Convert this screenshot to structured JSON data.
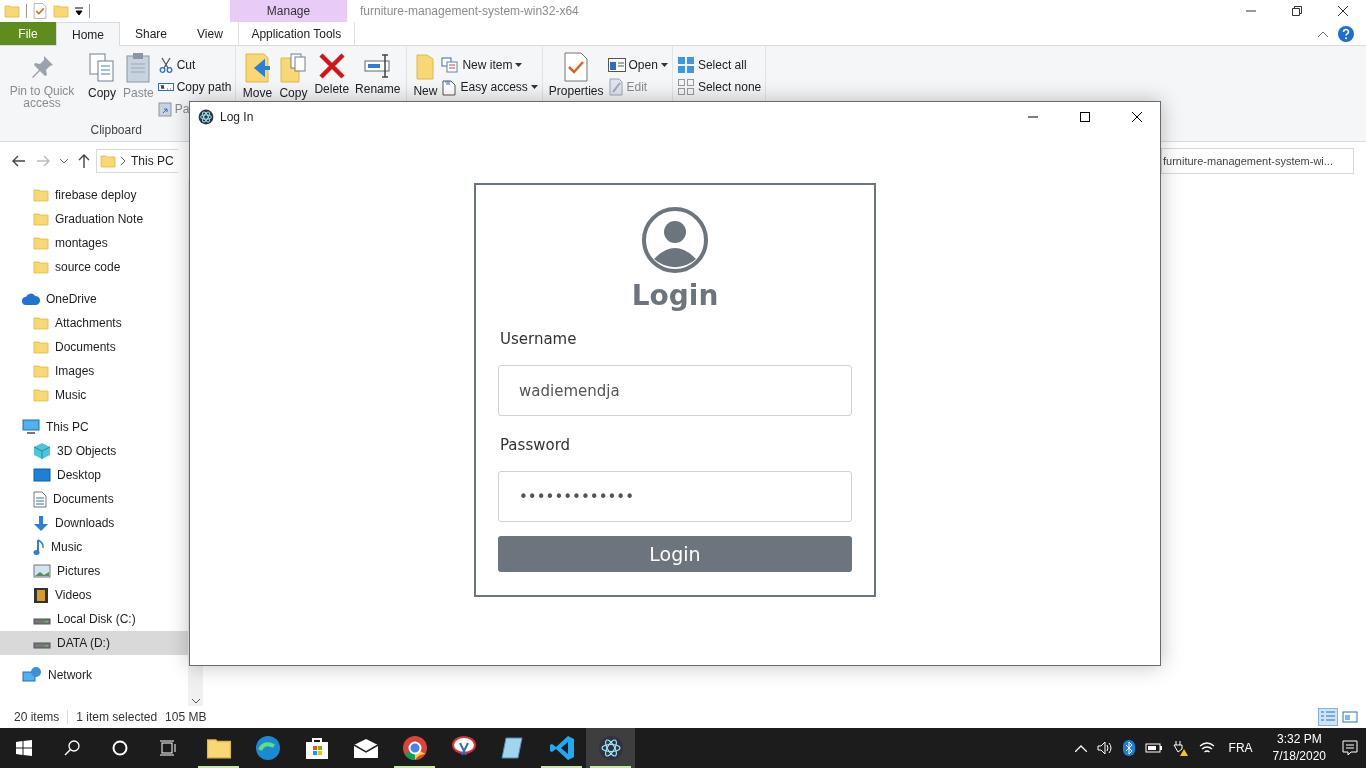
{
  "explorer": {
    "context_tab_header": "Manage",
    "title": "furniture-management-system-win32-x64",
    "tabs": [
      {
        "label": "File",
        "kind": "file",
        "selected": false
      },
      {
        "label": "Home",
        "kind": "tab",
        "selected": true
      },
      {
        "label": "Share",
        "kind": "tab",
        "selected": false
      },
      {
        "label": "View",
        "kind": "tab",
        "selected": false
      },
      {
        "label": "Application Tools",
        "kind": "context",
        "selected": false
      }
    ],
    "ribbon": {
      "groups": [
        {
          "label": "Clipboard",
          "items": [
            {
              "kind": "large",
              "label": "Pin to Quick access",
              "disabled": true
            },
            {
              "kind": "large",
              "label": "Copy",
              "disabled": false
            },
            {
              "kind": "large",
              "label": "Paste",
              "disabled": true
            },
            {
              "kind": "small",
              "label": "Cut",
              "disabled": false,
              "dropdown": false
            },
            {
              "kind": "small",
              "label": "Copy path",
              "disabled": false,
              "dropdown": false
            },
            {
              "kind": "small",
              "label": "Pa",
              "disabled": true,
              "dropdown": false
            }
          ]
        },
        {
          "items": [
            {
              "kind": "large",
              "label": "Move",
              "disabled": false
            },
            {
              "kind": "large",
              "label": "Copy",
              "disabled": false
            },
            {
              "kind": "large",
              "label": "Delete",
              "disabled": false
            },
            {
              "kind": "large",
              "label": "Rename",
              "disabled": false
            }
          ]
        },
        {
          "items": [
            {
              "kind": "large",
              "label": "New",
              "disabled": false
            },
            {
              "kind": "small",
              "label": "New item",
              "disabled": false,
              "dropdown": true
            },
            {
              "kind": "small",
              "label": "Easy access",
              "disabled": false,
              "dropdown": true
            }
          ]
        },
        {
          "items": [
            {
              "kind": "large",
              "label": "Properties",
              "disabled": false
            },
            {
              "kind": "small",
              "label": "Open",
              "disabled": false,
              "dropdown": true
            },
            {
              "kind": "small",
              "label": "Edit",
              "disabled": true,
              "dropdown": false
            }
          ]
        },
        {
          "items": [
            {
              "kind": "small",
              "label": "Select all",
              "disabled": false,
              "dropdown": false
            },
            {
              "kind": "small",
              "label": "Select none",
              "disabled": false,
              "dropdown": false
            }
          ]
        }
      ]
    },
    "address": {
      "crumb": "This PC"
    },
    "search": {
      "placeholder": "furniture-management-system-wi..."
    },
    "sidebar": {
      "quick_access_children": [
        {
          "label": "firebase deploy",
          "kind": "folder",
          "selected": false
        },
        {
          "label": "Graduation Note",
          "kind": "folder",
          "selected": false
        },
        {
          "label": "montages",
          "kind": "folder",
          "selected": false
        },
        {
          "label": "source code",
          "kind": "folder",
          "selected": false
        }
      ],
      "items": [
        {
          "label": "OneDrive",
          "kind": "cloud",
          "selected": false,
          "children": [
            {
              "label": "Attachments",
              "kind": "folder",
              "selected": false
            },
            {
              "label": "Documents",
              "kind": "folder",
              "selected": false
            },
            {
              "label": "Images",
              "kind": "folder",
              "selected": false
            },
            {
              "label": "Music",
              "kind": "folder",
              "selected": false
            }
          ]
        },
        {
          "label": "This PC",
          "kind": "computer",
          "selected": false,
          "children": [
            {
              "label": "3D Objects",
              "kind": "cube",
              "selected": false
            },
            {
              "label": "Desktop",
              "kind": "desktop",
              "selected": false
            },
            {
              "label": "Documents",
              "kind": "document",
              "selected": false
            },
            {
              "label": "Downloads",
              "kind": "download",
              "selected": false
            },
            {
              "label": "Music",
              "kind": "music",
              "selected": false
            },
            {
              "label": "Pictures",
              "kind": "pictures",
              "selected": false
            },
            {
              "label": "Videos",
              "kind": "videos",
              "selected": false
            },
            {
              "label": "Local Disk (C:)",
              "kind": "disk",
              "selected": false
            },
            {
              "label": "DATA (D:)",
              "kind": "disk",
              "selected": true
            }
          ]
        },
        {
          "label": "Network",
          "kind": "network",
          "selected": false
        }
      ]
    },
    "status_bar": {
      "item_count": "20 items",
      "selection": "1 item selected",
      "size": "105 MB"
    }
  },
  "dialog": {
    "title": "Log In",
    "heading": "Login",
    "fields": [
      {
        "label": "Username",
        "value": "wadiemendja"
      },
      {
        "label": "Password",
        "value": "•••••••••••••"
      }
    ],
    "button": "Login"
  },
  "taskbar": {
    "apps": [
      {
        "running": true,
        "selected": false
      },
      {
        "running": false,
        "selected": false
      },
      {
        "running": false,
        "selected": false
      },
      {
        "running": false,
        "selected": false
      },
      {
        "running": true,
        "selected": false
      },
      {
        "running": false,
        "selected": false
      },
      {
        "running": false,
        "selected": false
      },
      {
        "running": true,
        "selected": false
      },
      {
        "running": true,
        "selected": true
      }
    ],
    "tray": {
      "language": "FRA",
      "time": "3:32 PM",
      "date": "7/18/2020"
    }
  }
}
